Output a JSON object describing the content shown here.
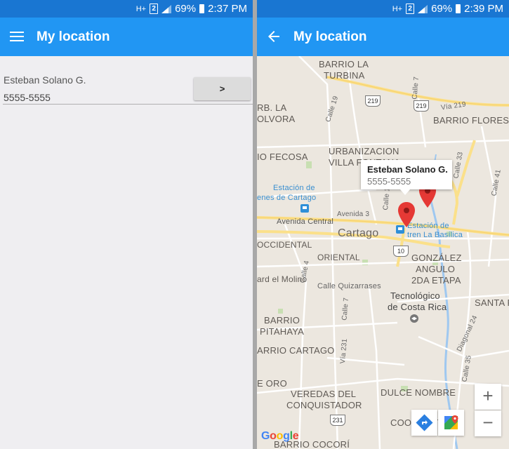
{
  "left_screen": {
    "status": {
      "signal_tag": "H+",
      "sim_number": "2",
      "battery": "69%",
      "time": "2:37 PM"
    },
    "app_bar": {
      "title": "My location",
      "menu_icon": "hamburger-menu-icon"
    },
    "form": {
      "name_value": "Esteban Solano G.",
      "phone_value": "5555-5555",
      "submit_label": ">"
    }
  },
  "right_screen": {
    "status": {
      "signal_tag": "H+",
      "sim_number": "2",
      "battery": "69%",
      "time": "2:39 PM"
    },
    "app_bar": {
      "title": "My location",
      "back_icon": "arrow-back-icon"
    },
    "map": {
      "info_window": {
        "title": "Esteban Solano G.",
        "subtitle": "5555-5555"
      },
      "labels": {
        "barrio_la_turbina_1": "BARRIO LA",
        "barrio_la_turbina_2": "TURBINA",
        "rb_la_1": "RB. LA",
        "rb_la_2": "OLVORA",
        "barrio_flores": "BARRIO FLORES",
        "fecosa": "IO FECOSA",
        "urbanizacion_1": "URBANIZACION",
        "urbanizacion_2": "VILLA FONTANA",
        "estacion_cartago_1": "Estación de",
        "estacion_cartago_2": "enes de Cartago",
        "avenida_3": "Avenida 3",
        "avenida_central": "Avenida Central",
        "cartago": "Cartago",
        "estacion_basilica_1": "Estación de",
        "estacion_basilica_2": "tren La Basílica",
        "occidental": "OCCIDENTAL",
        "oriental": "ORIENTAL",
        "gonzalez_1": "GONZÁLEZ",
        "gonzalez_2": "ANGULO",
        "gonzalez_3": "2DA ETAPA",
        "del_molino": "ard el Molino",
        "calle_quizarrases": "Calle Quizarrases",
        "tecnologico_1": "Tecnológico",
        "tecnologico_2": "de Costa Rica",
        "santa_f": "SANTA F",
        "barrio_pitahaya_1": "BARRIO",
        "barrio_pitahaya_2": "PITAHAYA",
        "barrio_cartago": "ARRIO CARTAGO",
        "e_oro": "E ORO",
        "veredas_1": "VEREDAS DEL",
        "veredas_2": "CONQUISTADOR",
        "dulce_nombre": "DULCE NOMBRE",
        "cooperativa": "COOPERATIVA",
        "barrio_cocori": "BARRIO COCORÍ",
        "calle_19": "Calle 19",
        "calle_7": "Calle 7",
        "calle_33": "Calle 33",
        "via_219": "Vía 219",
        "calle_41": "Calle 41",
        "calle_15": "Calle 15",
        "calle_4": "Calle 4",
        "calle_7b": "Calle 7",
        "via_231": "Vía 231",
        "diagonal_24": "Diagonal 24",
        "calle_35": "Calle 35"
      },
      "route_shields": {
        "r219a": "219",
        "r219b": "219",
        "r10": "10",
        "r231": "231"
      },
      "zoom_in": "+",
      "zoom_out": "−",
      "directions_icon": "directions-icon",
      "maps_app_icon": "google-maps-icon",
      "attribution": "Google"
    }
  },
  "colors": {
    "status_bar": "#1976d2",
    "app_bar": "#2196f3",
    "map_background": "#ece7df",
    "road_yellow": "#fbe08a",
    "river": "#9fc8f0",
    "pin_red": "#e53935"
  }
}
